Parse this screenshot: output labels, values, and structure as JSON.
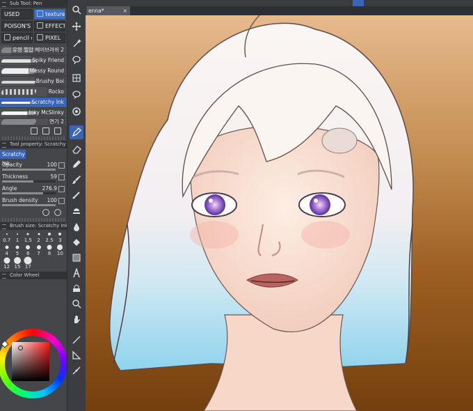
{
  "subtool_panel": {
    "title": "Sub Tool: Pen"
  },
  "tabs": [
    {
      "label": "USED",
      "active": false
    },
    {
      "label": "textures",
      "active": true
    },
    {
      "label": "POISON'S",
      "active": false
    },
    {
      "label": "EFFECTS",
      "active": false
    },
    {
      "label": "pencil case",
      "active": false
    },
    {
      "label": "PIXEL",
      "active": false
    }
  ],
  "brushes": [
    {
      "label": "유령 필압 헤어브러쉬 2",
      "selected": false,
      "stroke": "#b9b9b9"
    },
    {
      "label": "Spiky Friend",
      "selected": false,
      "stroke": "#e0e0e0"
    },
    {
      "label": "Messy Round",
      "selected": false,
      "stroke": "#ededed"
    },
    {
      "label": "Brushy Boi",
      "selected": false,
      "stroke": "#d6d6d6"
    },
    {
      "label": "Rocko",
      "selected": false,
      "stroke": "#cfcfcf"
    },
    {
      "label": "Scratchy Ink",
      "selected": true,
      "stroke": "#ffffff"
    },
    {
      "label": "Inky McSlinky",
      "selected": false,
      "stroke": "#f4f4f4"
    },
    {
      "label": "연기 2",
      "selected": false,
      "stroke": "#bdbdbd"
    }
  ],
  "tool_property": {
    "title": "Tool property: Scratchy Ink",
    "current": "Scratchy Ink",
    "props": [
      {
        "name": "Opacity",
        "value": "100",
        "level": 1.0
      },
      {
        "name": "Thickness",
        "value": "59",
        "level": 0.59
      },
      {
        "name": "Angle",
        "value": "276.9",
        "level": 0.77
      },
      {
        "name": "Brush density",
        "value": "100",
        "level": 1.0
      }
    ]
  },
  "brush_size": {
    "title": "Brush size: Scratchy Ink",
    "sizes": [
      "0.7",
      "1",
      "1.5",
      "2",
      "2.5",
      "3",
      "4",
      "5",
      "6",
      "7",
      "8",
      "10",
      "12",
      "15",
      "17"
    ]
  },
  "color_panel": {
    "title": "Color Wheel",
    "main_color": "#e8b5aa",
    "sub_color": "#a8101f"
  },
  "document": {
    "tab_title": "enna*",
    "close": "×"
  },
  "accent": "#3a64b8"
}
